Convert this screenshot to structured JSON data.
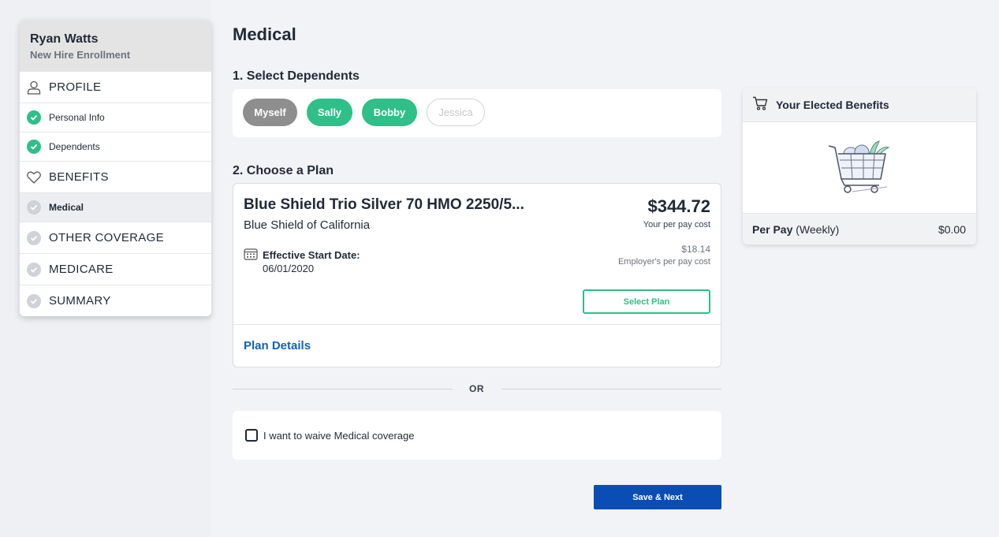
{
  "sidebar": {
    "user_name": "Ryan Watts",
    "subtitle": "New Hire Enrollment",
    "items": [
      {
        "label": "PROFILE",
        "type": "section",
        "icon": "person-icon"
      },
      {
        "label": "Personal Info",
        "type": "sub",
        "status": "complete"
      },
      {
        "label": "Dependents",
        "type": "sub",
        "status": "complete"
      },
      {
        "label": "BENEFITS",
        "type": "section",
        "icon": "heart-icon"
      },
      {
        "label": "Medical",
        "type": "sub",
        "status": "current"
      },
      {
        "label": "OTHER COVERAGE",
        "type": "section",
        "status": "pending"
      },
      {
        "label": "MEDICARE",
        "type": "section",
        "status": "pending"
      },
      {
        "label": "SUMMARY",
        "type": "section",
        "status": "pending"
      }
    ]
  },
  "main": {
    "title": "Medical",
    "dependents_heading": "1. Select Dependents",
    "dependents": [
      {
        "label": "Myself",
        "state": "locked",
        "color": "#8e8e8e"
      },
      {
        "label": "Sally",
        "state": "selected",
        "color": "#2fbf88"
      },
      {
        "label": "Bobby",
        "state": "selected",
        "color": "#2fbf88"
      },
      {
        "label": "Jessica",
        "state": "unselected",
        "color": "#ffffff"
      }
    ],
    "plan_heading": "2. Choose a Plan",
    "plan": {
      "name": "Blue Shield Trio Silver 70 HMO 2250/5...",
      "carrier": "Blue Shield of California",
      "price": "$344.72",
      "price_caption": "Your per pay cost",
      "employer_price": "$18.14",
      "employer_caption": "Employer's per pay cost",
      "effective_label": "Effective Start Date:",
      "effective_date": "06/01/2020",
      "select_label": "Select Plan",
      "details_label": "Plan Details"
    },
    "or_label": "OR",
    "waive_label": "I want to waive Medical coverage",
    "save_label": "Save & Next"
  },
  "elected": {
    "title": "Your Elected Benefits",
    "per_pay_label": "Per Pay",
    "per_pay_period": "(Weekly)",
    "amount": "$0.00"
  },
  "colors": {
    "accent_green": "#2fbf88",
    "primary_blue": "#0a4db4",
    "link_blue": "#1262b8"
  }
}
